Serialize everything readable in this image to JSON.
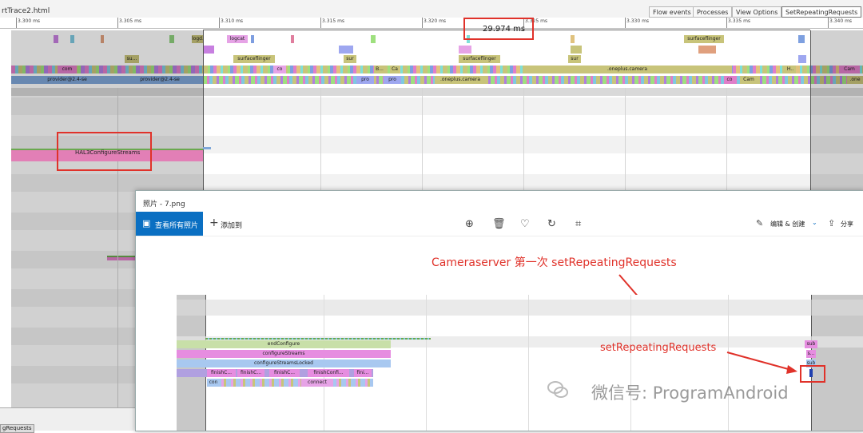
{
  "window": {
    "file_title": "rtTrace2.html"
  },
  "toolbar": {
    "flow_events": "Flow events",
    "processes": "Processes",
    "view_options": "View Options",
    "search_value": "SetRepeatingRequests"
  },
  "ruler": {
    "ticks": [
      "3.300 ms",
      "3.305 ms",
      "3.310 ms",
      "3.315 ms",
      "3.320 ms",
      "3.325 ms",
      "3.330 ms",
      "3.335 ms",
      "3.340 ms"
    ]
  },
  "measure": {
    "label": "29.974 ms"
  },
  "tracks": {
    "row1": [
      "logd.writer",
      "logcat",
      "surfaceflinger"
    ],
    "row2": [
      "su...",
      "surfaceflinger",
      "sur",
      "surfaceflinger",
      "sur"
    ],
    "row3": [
      "com",
      "co",
      "B...",
      "Ca",
      ".oneplus.camera",
      "H..",
      "Cam"
    ],
    "row4": [
      "provider@2.4-se",
      "provider@2.4-se",
      "pro",
      "pro",
      ".oneplus.camera",
      "co",
      "Cam",
      ".one"
    ]
  },
  "timeline": {
    "hal_slice": "HAL3ConfigureStreams"
  },
  "bottom": {
    "tab": "gRequests"
  },
  "photos": {
    "title": "照片 - 7.png",
    "view_all": "查看所有照片",
    "add_to": "添加到",
    "edit_create": "编辑 & 创建",
    "share": "分享",
    "annotation_title": "Cameraserver 第一次 setRepeatingRequests",
    "annotation_setrepeating": "setRepeatingRequests",
    "watermark": "微信号: ProgramAndroid",
    "inner_slices": {
      "end_configure": "endConfigure",
      "configure_streams": "configureStreams",
      "configure_streams_locked": "configureStreamsLocked",
      "finish": [
        "finishC...",
        "finishC...",
        "finishC...",
        "finishConfi...",
        "fini..."
      ],
      "connect": [
        "con",
        "connect"
      ],
      "right": [
        "sub",
        "s...",
        "sub"
      ]
    }
  },
  "colors": {
    "accent_red": "#e0322a",
    "photos_blue": "#0a6fc2",
    "hal_pink": "#e27fb6",
    "camera_olive": "#c8c47a",
    "provider_blue": "#7fa7d8"
  }
}
